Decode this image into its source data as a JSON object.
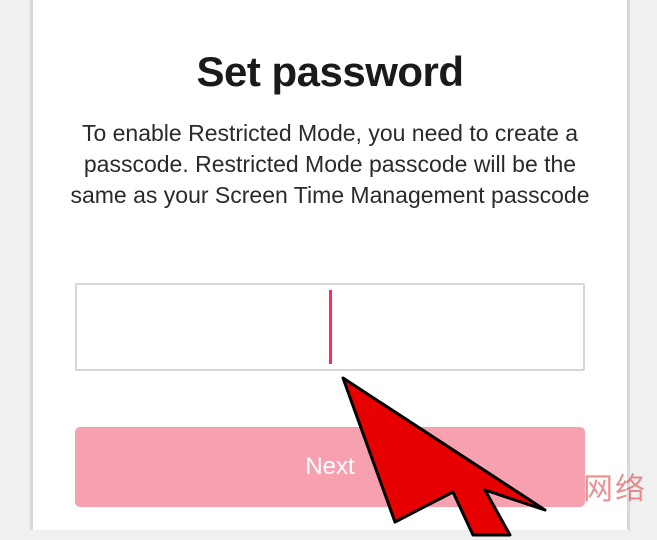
{
  "header": {
    "title": "Set password"
  },
  "body": {
    "description": "To enable Restricted Mode, you need to create a passcode. Restricted Mode passcode will be the same as your Screen Time Management passcode"
  },
  "input": {
    "value": "",
    "placeholder": ""
  },
  "actions": {
    "next_label": "Next"
  },
  "overlay": {
    "watermark_text": "网络"
  },
  "colors": {
    "accent": "#fe2c55",
    "button_disabled_bg": "#f7a0b0",
    "button_text": "#ffffff",
    "border": "#d6d6d6"
  }
}
